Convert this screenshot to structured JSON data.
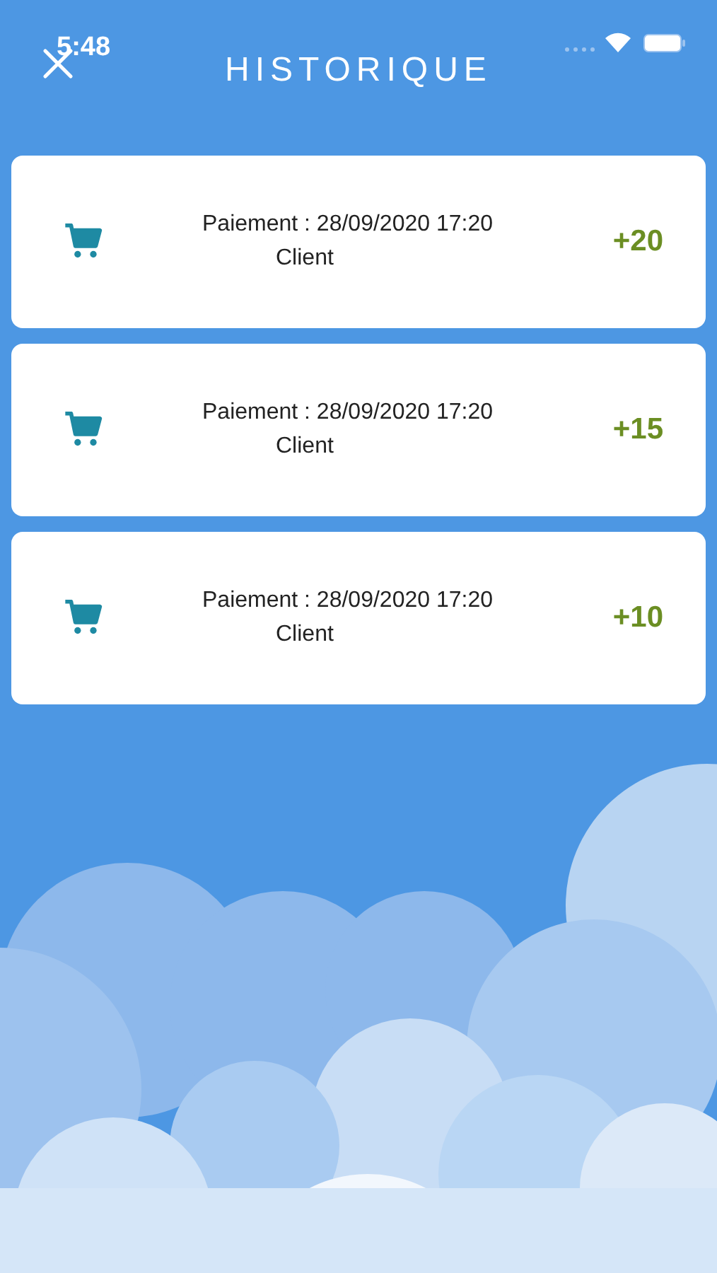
{
  "status_bar": {
    "time": "5:48"
  },
  "header": {
    "title": "HISTORIQUE"
  },
  "transactions": [
    {
      "label": "Paiement : 28/09/2020 17:20",
      "party": "Client",
      "amount": "+20"
    },
    {
      "label": "Paiement : 28/09/2020 17:20",
      "party": "Client",
      "amount": "+15"
    },
    {
      "label": "Paiement : 28/09/2020 17:20",
      "party": "Client",
      "amount": "+10"
    }
  ]
}
